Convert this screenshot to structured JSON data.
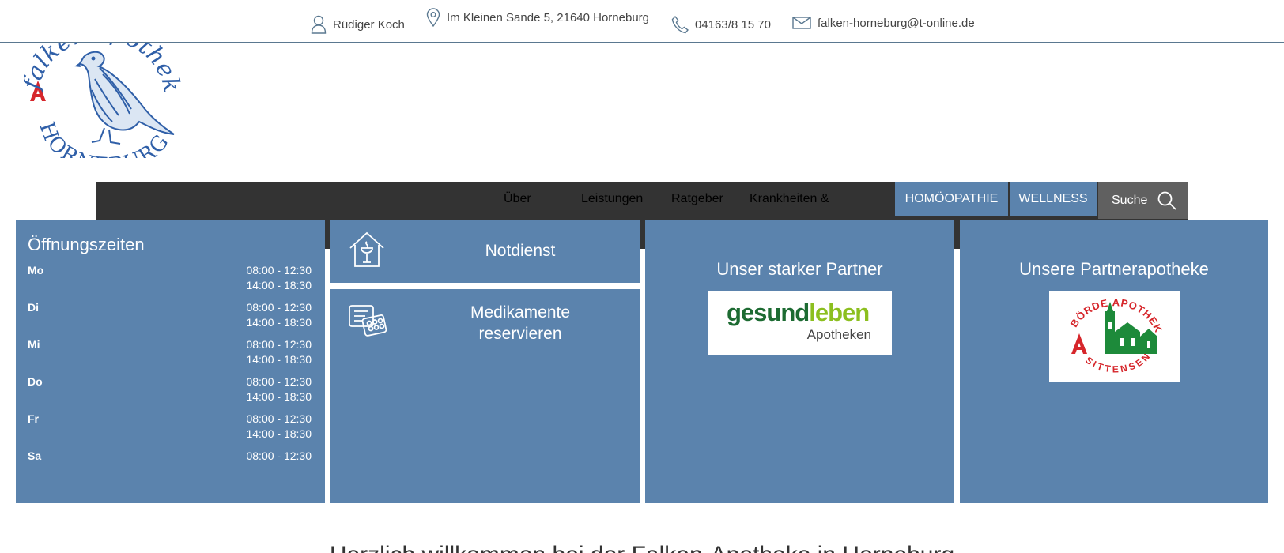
{
  "contact": {
    "name": "Rüdiger Koch",
    "address": "Im Kleinen Sande 5, 21640 Horneburg",
    "phone": "04163/8 15 70",
    "email": "falken-horneburg@t-online.de"
  },
  "nav": {
    "items": [
      "Über",
      "Leistungen",
      "Ratgeber",
      "Krankheiten &"
    ],
    "homoeopathie": "HOMÖOPATHIE",
    "wellness": "WELLNESS",
    "search": "Suche"
  },
  "hours": {
    "title": "Öffnungszeiten",
    "rows": [
      {
        "day": "Mo",
        "times": [
          "08:00 - 12:30",
          "14:00 - 18:30"
        ]
      },
      {
        "day": "Di",
        "times": [
          "08:00 - 12:30",
          "14:00 - 18:30"
        ]
      },
      {
        "day": "Mi",
        "times": [
          "08:00 - 12:30",
          "14:00 - 18:30"
        ]
      },
      {
        "day": "Do",
        "times": [
          "08:00 - 12:30",
          "14:00 - 18:30"
        ]
      },
      {
        "day": "Fr",
        "times": [
          "08:00 - 12:30",
          "14:00 - 18:30"
        ]
      },
      {
        "day": "Sa",
        "times": [
          "08:00 - 12:30"
        ]
      }
    ]
  },
  "tiles": {
    "notdienst": "Notdienst",
    "medikamente_line1": "Medikamente",
    "medikamente_line2": "reservieren",
    "partner_title": "Unser starker Partner",
    "partner_logo_text1": "gesund",
    "partner_logo_text2": "leben",
    "partner_logo_sub": "Apotheken",
    "partner2_title": "Unsere Partnerapotheke",
    "partner2_logo_top": "BÖRDE APOTHEKE",
    "partner2_logo_bottom": "SITTENSEN"
  },
  "logo": {
    "text_top": "falken apotheke",
    "text_bottom": "HORNEBURG"
  },
  "welcome": "Herzlich willkommen bei der Falken-Apotheke in Horneburg",
  "colors": {
    "tile_blue": "#5b83ad",
    "nav_dark": "#333333",
    "search_grey": "#606060",
    "logo_blue": "#2f5fa8",
    "logo_red": "#d6262b"
  }
}
